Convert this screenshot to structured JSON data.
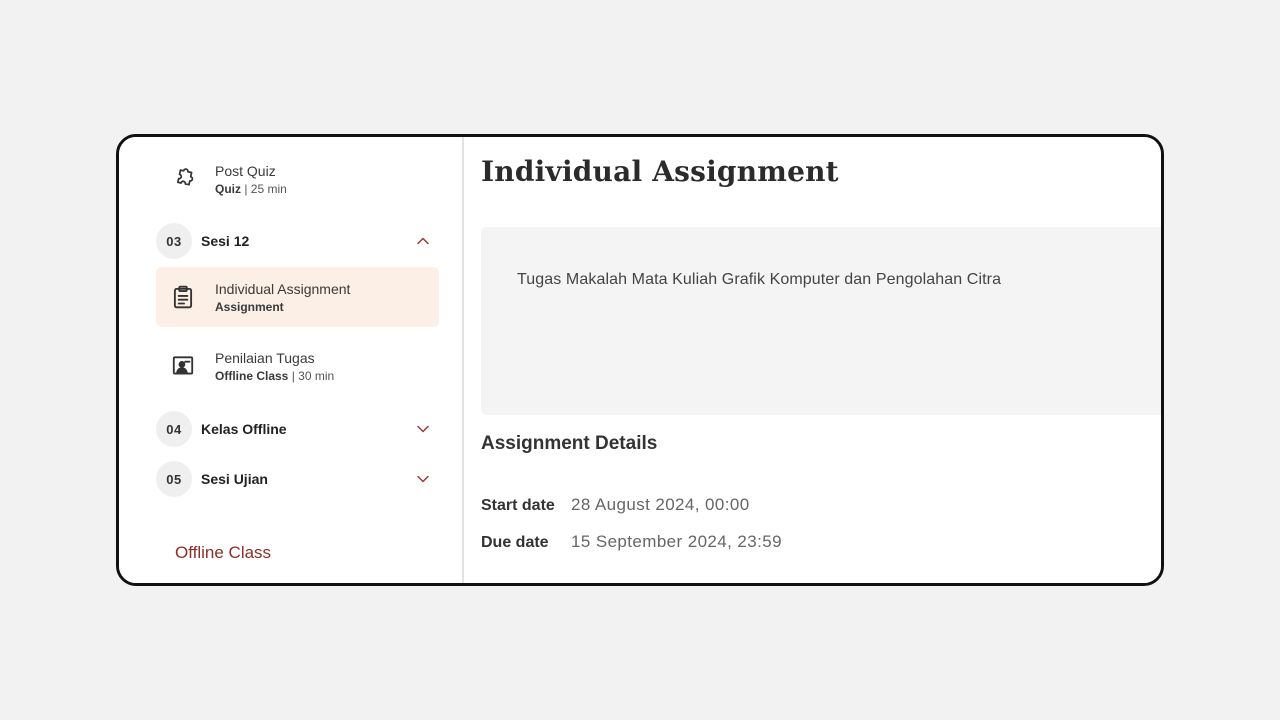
{
  "sidebar": {
    "items": [
      {
        "type": "lesson",
        "icon": "puzzle-icon",
        "title": "Post Quiz",
        "meta_type": "Quiz",
        "meta_duration": " | 25 min"
      },
      {
        "type": "session",
        "number": "03",
        "name": "Sesi 12",
        "expanded": true
      },
      {
        "type": "lesson",
        "icon": "clipboard-icon",
        "title": "Individual Assignment",
        "meta_type": "Assignment",
        "meta_duration": "",
        "active": true
      },
      {
        "type": "lesson",
        "icon": "presentation-icon",
        "title": "Penilaian Tugas",
        "meta_type": "Offline Class",
        "meta_duration": " | 30 min"
      },
      {
        "type": "session",
        "number": "04",
        "name": "Kelas Offline",
        "expanded": false
      },
      {
        "type": "session",
        "number": "05",
        "name": "Sesi Ujian",
        "expanded": false
      }
    ],
    "offline_link": "Offline Class"
  },
  "main": {
    "title": "Individual Assignment",
    "description": "Tugas Makalah Mata Kuliah Grafik Komputer dan Pengolahan Citra",
    "details_heading": "Assignment Details",
    "start_label": "Start date",
    "start_value": "28 August 2024, 00:00",
    "due_label": "Due date",
    "due_value": "15 September 2024, 23:59"
  },
  "colors": {
    "accent": "#8b2f26",
    "active_bg": "#fbefe6",
    "chevron": "#9b3a30"
  }
}
